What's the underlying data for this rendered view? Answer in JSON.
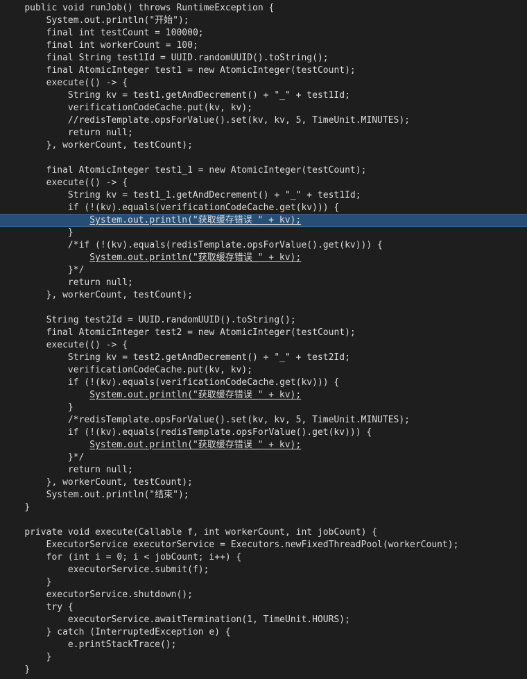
{
  "editor": {
    "lines": [
      {
        "indent": "    ",
        "text": "public void runJob() throws RuntimeException {"
      },
      {
        "indent": "        ",
        "text": "System.out.println(\"开始\");"
      },
      {
        "indent": "        ",
        "text": "final int testCount = 100000;"
      },
      {
        "indent": "        ",
        "text": "final int workerCount = 100;"
      },
      {
        "indent": "        ",
        "text": "final String test1Id = UUID.randomUUID().toString();"
      },
      {
        "indent": "        ",
        "text": "final AtomicInteger test1 = new AtomicInteger(testCount);"
      },
      {
        "indent": "        ",
        "text": "execute(() -> {"
      },
      {
        "indent": "            ",
        "text": "String kv = test1.getAndDecrement() + \"_\" + test1Id;"
      },
      {
        "indent": "            ",
        "text": "verificationCodeCache.put(kv, kv);"
      },
      {
        "indent": "            ",
        "text": "//redisTemplate.opsForValue().set(kv, kv, 5, TimeUnit.MINUTES);"
      },
      {
        "indent": "            ",
        "text": "return null;"
      },
      {
        "indent": "        ",
        "text": "}, workerCount, testCount);"
      },
      {
        "indent": "",
        "text": ""
      },
      {
        "indent": "        ",
        "text": "final AtomicInteger test1_1 = new AtomicInteger(testCount);"
      },
      {
        "indent": "        ",
        "text": "execute(() -> {"
      },
      {
        "indent": "            ",
        "text": "String kv = test1_1.getAndDecrement() + \"_\" + test1Id;"
      },
      {
        "indent": "            ",
        "text": "if (!(kv).equals(verificationCodeCache.get(kv))) {"
      },
      {
        "indent": "                ",
        "text": "System.out.println(\"获取缓存错误_\" + kv);",
        "underline": true,
        "highlight": true
      },
      {
        "indent": "            ",
        "text": "}"
      },
      {
        "indent": "            ",
        "text": "/*if (!(kv).equals(redisTemplate.opsForValue().get(kv))) {"
      },
      {
        "indent": "                ",
        "text": "System.out.println(\"获取缓存错误_\" + kv);",
        "underline": true
      },
      {
        "indent": "            ",
        "text": "}*/"
      },
      {
        "indent": "            ",
        "text": "return null;"
      },
      {
        "indent": "        ",
        "text": "}, workerCount, testCount);"
      },
      {
        "indent": "",
        "text": ""
      },
      {
        "indent": "        ",
        "text": "String test2Id = UUID.randomUUID().toString();"
      },
      {
        "indent": "        ",
        "text": "final AtomicInteger test2 = new AtomicInteger(testCount);"
      },
      {
        "indent": "        ",
        "text": "execute(() -> {"
      },
      {
        "indent": "            ",
        "text": "String kv = test2.getAndDecrement() + \"_\" + test2Id;"
      },
      {
        "indent": "            ",
        "text": "verificationCodeCache.put(kv, kv);"
      },
      {
        "indent": "            ",
        "text": "if (!(kv).equals(verificationCodeCache.get(kv))) {"
      },
      {
        "indent": "                ",
        "text": "System.out.println(\"获取缓存错误_\" + kv);",
        "underline": true
      },
      {
        "indent": "            ",
        "text": "}"
      },
      {
        "indent": "            ",
        "text": "/*redisTemplate.opsForValue().set(kv, kv, 5, TimeUnit.MINUTES);"
      },
      {
        "indent": "            ",
        "text": "if (!(kv).equals(redisTemplate.opsForValue().get(kv))) {"
      },
      {
        "indent": "                ",
        "text": "System.out.println(\"获取缓存错误_\" + kv);",
        "underline": true
      },
      {
        "indent": "            ",
        "text": "}*/"
      },
      {
        "indent": "            ",
        "text": "return null;"
      },
      {
        "indent": "        ",
        "text": "}, workerCount, testCount);"
      },
      {
        "indent": "        ",
        "text": "System.out.println(\"结束\");"
      },
      {
        "indent": "    ",
        "text": "}"
      },
      {
        "indent": "",
        "text": ""
      },
      {
        "indent": "    ",
        "text": "private void execute(Callable f, int workerCount, int jobCount) {"
      },
      {
        "indent": "        ",
        "text": "ExecutorService executorService = Executors.newFixedThreadPool(workerCount);"
      },
      {
        "indent": "        ",
        "text": "for (int i = 0; i < jobCount; i++) {"
      },
      {
        "indent": "            ",
        "text": "executorService.submit(f);"
      },
      {
        "indent": "        ",
        "text": "}"
      },
      {
        "indent": "        ",
        "text": "executorService.shutdown();"
      },
      {
        "indent": "        ",
        "text": "try {"
      },
      {
        "indent": "            ",
        "text": "executorService.awaitTermination(1, TimeUnit.HOURS);"
      },
      {
        "indent": "        ",
        "text": "} catch (InterruptedException e) {"
      },
      {
        "indent": "            ",
        "text": "e.printStackTrace();"
      },
      {
        "indent": "        ",
        "text": "}"
      },
      {
        "indent": "    ",
        "text": "}"
      }
    ]
  }
}
